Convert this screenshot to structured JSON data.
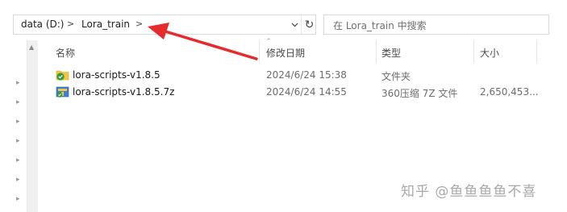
{
  "address_bar": {
    "crumbs": [
      "data (D:)",
      "Lora_train"
    ],
    "separator": ">",
    "dropdown_icon": "chevron-down-icon",
    "refresh_icon": "refresh-icon",
    "refresh_glyph": "↻"
  },
  "search": {
    "placeholder": "在 Lora_train 中搜索"
  },
  "columns": {
    "name": "名称",
    "modified": "修改日期",
    "type": "类型",
    "size": "大小"
  },
  "files": [
    {
      "icon": "folder-icon",
      "name": "lora-scripts-v1.8.5",
      "modified": "2024/6/24 15:38",
      "type": "文件夹",
      "size": ""
    },
    {
      "icon": "7z-archive-icon",
      "name": "lora-scripts-v1.8.5.7z",
      "modified": "2024/6/24 14:55",
      "type": "360压缩 7Z 文件",
      "size": "2,650,453..."
    }
  ],
  "watermark": "知乎 @鱼鱼鱼鱼不喜",
  "colors": {
    "annotation_arrow": "#e52b2b",
    "folder": "#f4c542",
    "sync_check": "#2e9e3a"
  }
}
